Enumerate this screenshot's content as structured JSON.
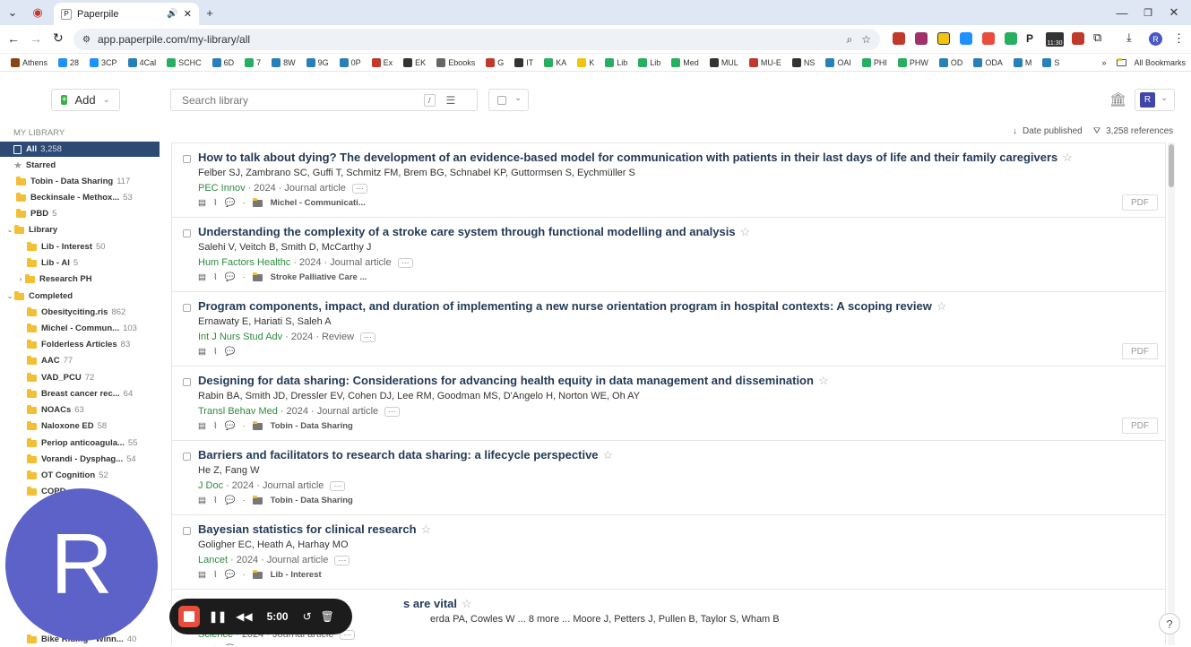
{
  "browser": {
    "tab_title": "Paperpile",
    "url": "app.paperpile.com/my-library/all",
    "bookmarks": [
      "Athens",
      "28",
      "3CP",
      "4Cal",
      "SCHC",
      "6D",
      "7",
      "8W",
      "9G",
      "0P",
      "Ex",
      "EK",
      "Ebooks",
      "G",
      "IT",
      "KA",
      "K",
      "Lib",
      "Lib",
      "Med",
      "MUL",
      "MU-E",
      "NS",
      "OAI",
      "PHI",
      "PHW",
      "OD",
      "ODA",
      "M",
      "S"
    ],
    "all_bookmarks": "All Bookmarks",
    "ext_time": "11:30"
  },
  "header": {
    "add_label": "Add",
    "search_placeholder": "Search library",
    "search_shortcut": "/",
    "user_initial": "R"
  },
  "sidebar": {
    "section": "MY LIBRARY",
    "items": [
      {
        "label": "All",
        "count": "3,258"
      },
      {
        "label": "Starred",
        "count": ""
      },
      {
        "label": "Tobin - Data Sharing",
        "count": "117"
      },
      {
        "label": "Beckinsale - Methox...",
        "count": "53"
      },
      {
        "label": "PBD",
        "count": "5"
      },
      {
        "label": "Library",
        "count": ""
      },
      {
        "label": "Lib - Interest",
        "count": "50"
      },
      {
        "label": "Lib - AI",
        "count": "5"
      },
      {
        "label": "Research PH",
        "count": ""
      },
      {
        "label": "Completed",
        "count": ""
      },
      {
        "label": "Obesityciting.ris",
        "count": "862"
      },
      {
        "label": "Michel - Commun...",
        "count": "103"
      },
      {
        "label": "Folderless Articles",
        "count": "83"
      },
      {
        "label": "AAC",
        "count": "77"
      },
      {
        "label": "VAD_PCU",
        "count": "72"
      },
      {
        "label": "Breast cancer rec...",
        "count": "64"
      },
      {
        "label": "NOACs",
        "count": "63"
      },
      {
        "label": "Naloxone ED",
        "count": "58"
      },
      {
        "label": "Periop anticoagula...",
        "count": "55"
      },
      {
        "label": "Vorandi - Dysphag...",
        "count": "54"
      },
      {
        "label": "OT Cognition",
        "count": "52"
      },
      {
        "label": "COPD",
        "count": ""
      },
      {
        "label": "Bike Riding - Winn...",
        "count": "40"
      }
    ]
  },
  "list": {
    "sort_label": "Date published",
    "count_label": "3,258 references",
    "rows": [
      {
        "title": "How to talk about dying? The development of an evidence-based model for communication with patients in their last days of life and their family caregivers",
        "authors": "Felber SJ, Zambrano SC, Guffi T, Schmitz FM, Brem BG, Schnabel KP, Guttormsen S, Eychmüller S",
        "journal": "PEC Innov",
        "year": "2024",
        "type": "Journal article",
        "folder": "Michel - Communicati...",
        "pdf": "PDF"
      },
      {
        "title": "Understanding the complexity of a stroke care system through functional modelling and analysis",
        "authors": "Salehi V, Veitch B, Smith D, McCarthy J",
        "journal": "Hum Factors Healthc",
        "year": "2024",
        "type": "Journal article",
        "folder": "Stroke Palliative Care ...",
        "pdf": ""
      },
      {
        "title": "Program components, impact, and duration of implementing a new nurse orientation program in hospital contexts: A scoping review",
        "authors": "Ernawaty E, Hariati S, Saleh A",
        "journal": "Int J Nurs Stud Adv",
        "year": "2024",
        "type": "Review",
        "folder": "",
        "pdf": "PDF"
      },
      {
        "title": "Designing for data sharing: Considerations for advancing health equity in data management and dissemination",
        "authors": "Rabin BA, Smith JD, Dressler EV, Cohen DJ, Lee RM, Goodman MS, D'Angelo H, Norton WE, Oh AY",
        "journal": "Transl Behav Med",
        "year": "2024",
        "type": "Journal article",
        "folder": "Tobin - Data Sharing",
        "pdf": "PDF"
      },
      {
        "title": "Barriers and facilitators to research data sharing: a lifecycle perspective",
        "authors": "He Z, Fang W",
        "journal": "J Doc",
        "year": "2024",
        "type": "Journal article",
        "folder": "Tobin - Data Sharing",
        "pdf": ""
      },
      {
        "title": "Bayesian statistics for clinical research",
        "authors": "Goligher EC, Heath A, Harhay MO",
        "journal": "Lancet",
        "year": "2024",
        "type": "Journal article",
        "folder": "Lib - Interest",
        "pdf": ""
      },
      {
        "title": "s are vital",
        "authors": "erda PA, Cowles W ... 8 more ... Moore J, Petters J, Pullen B, Taylor S, Wham B",
        "journal": "Science",
        "year": "2024",
        "type": "Journal article",
        "folder": "",
        "pdf": ""
      }
    ]
  },
  "overlay": {
    "avatar_letter": "R",
    "timer": "5:00",
    "help": "?"
  }
}
